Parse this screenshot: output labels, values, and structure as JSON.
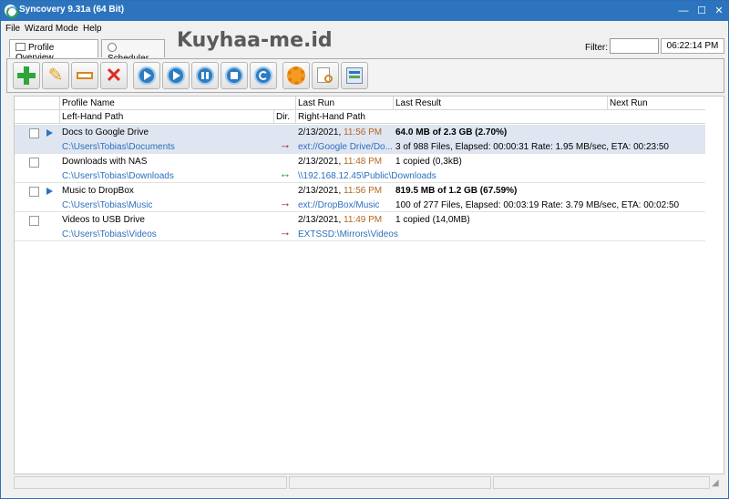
{
  "window": {
    "title": "Syncovery 9.31a (64 Bit)",
    "watermark": "Kuyhaa-me.id"
  },
  "menu": [
    "File",
    "Wizard Mode",
    "Help"
  ],
  "tabs": [
    {
      "label": "Profile Overview"
    },
    {
      "label": "Scheduler"
    }
  ],
  "filter": {
    "label": "Filter:",
    "value": ""
  },
  "clock": "06:22:14 PM",
  "toolbar": [
    {
      "icon": "add-icon"
    },
    {
      "icon": "edit-icon"
    },
    {
      "icon": "rename-icon"
    },
    {
      "icon": "delete-icon"
    },
    {
      "icon": "run-icon"
    },
    {
      "icon": "run-attended-icon"
    },
    {
      "icon": "pause-icon"
    },
    {
      "icon": "stop-icon"
    },
    {
      "icon": "refresh-icon"
    },
    {
      "icon": "settings-icon"
    },
    {
      "icon": "log-icon"
    },
    {
      "icon": "tools-icon"
    }
  ],
  "columns": {
    "row1": [
      "Profile Name",
      "Last Run",
      "Last Result",
      "Next Run"
    ],
    "row2": [
      "Left-Hand Path",
      "Dir.",
      "Right-Hand Path"
    ]
  },
  "profiles": [
    {
      "name": "Docs to Google Drive",
      "running": true,
      "left": "C:\\Users\\Tobias\\Documents",
      "dir": "→",
      "date": "2/13/2021,",
      "time": "11:56 PM",
      "right": "ext://Google Drive/Do...",
      "result1": "64.0 MB of 2.3 GB (2.70%)",
      "result1_bold": true,
      "result2": "3 of 988 Files, Elapsed: 00:00:31  Rate: 1.95 MB/sec, ETA: 00:23:50"
    },
    {
      "name": "Downloads with NAS",
      "running": false,
      "left": "C:\\Users\\Tobias\\Downloads",
      "dir": "↔",
      "date": "2/13/2021,",
      "time": "11:48 PM",
      "right": "\\\\192.168.12.45\\Public\\Downloads",
      "result1": "1 copied (0,3kB)",
      "result1_bold": false,
      "result2": ""
    },
    {
      "name": "Music to DropBox",
      "running": true,
      "left": "C:\\Users\\Tobias\\Music",
      "dir": "→",
      "date": "2/13/2021,",
      "time": "11:56 PM",
      "right": "ext://DropBox/Music",
      "result1": "819.5 MB of 1.2 GB (67.59%)",
      "result1_bold": true,
      "result2": "100 of 277 Files, Elapsed: 00:03:19  Rate: 3.79 MB/sec, ETA: 00:02:50"
    },
    {
      "name": "Videos to USB Drive",
      "running": false,
      "left": "C:\\Users\\Tobias\\Videos",
      "dir": "→",
      "date": "2/13/2021,",
      "time": "11:49 PM",
      "right": "EXTSSD:\\Mirrors\\Videos",
      "result1": "1 copied (14,0MB)",
      "result1_bold": false,
      "result2": ""
    }
  ],
  "colors": {
    "titlebar": "#2d74bf",
    "path": "#2c6fbe",
    "time": "#b5651d",
    "arrow_red": "#9b1c1c",
    "arrow_green": "#2a9a3a",
    "selected_row": "#dfe6f2"
  }
}
